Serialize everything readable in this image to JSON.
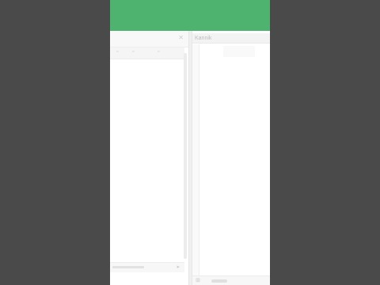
{
  "colors": {
    "background": "#4a4a4a",
    "banner": "#4db36e",
    "panel": "#ffffff"
  },
  "right_pane": {
    "tab_label": "Kannik"
  },
  "icons": {
    "left_close": "close-icon",
    "toolbar": [
      "toolbar-icon-a",
      "toolbar-icon-b",
      "toolbar-icon-c"
    ],
    "footer_arrow": "chevron-right-icon",
    "right_footer": "grid-icon"
  }
}
